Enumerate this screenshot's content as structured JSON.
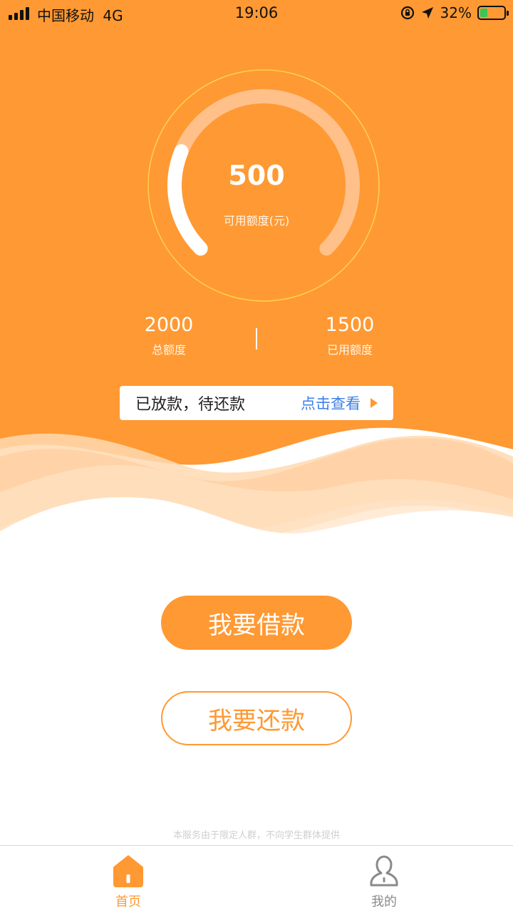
{
  "status_bar": {
    "carrier": "中国移动",
    "network": "4G",
    "time": "19:06",
    "battery_percent": "32%",
    "battery_level": 0.32
  },
  "credit": {
    "available_value": "500",
    "available_label": "可用额度(元)",
    "available_fraction": 0.25,
    "total_value": "2000",
    "total_label": "总额度",
    "used_value": "1500",
    "used_label": "已用额度"
  },
  "notice": {
    "status_text": "已放款，待还款",
    "link_text": "点击查看",
    "link_color": "#3d7fe6"
  },
  "actions": {
    "borrow_label": "我要借款",
    "repay_label": "我要还款"
  },
  "disclaimer": "本服务由于限定人群，不向学生群体提供",
  "tabs": [
    {
      "label": "首页",
      "icon": "home-icon",
      "active": true
    },
    {
      "label": "我的",
      "icon": "user-icon",
      "active": false
    }
  ],
  "colors": {
    "brand_orange": "#ff9933",
    "inactive_gray": "#8a8a8a"
  }
}
